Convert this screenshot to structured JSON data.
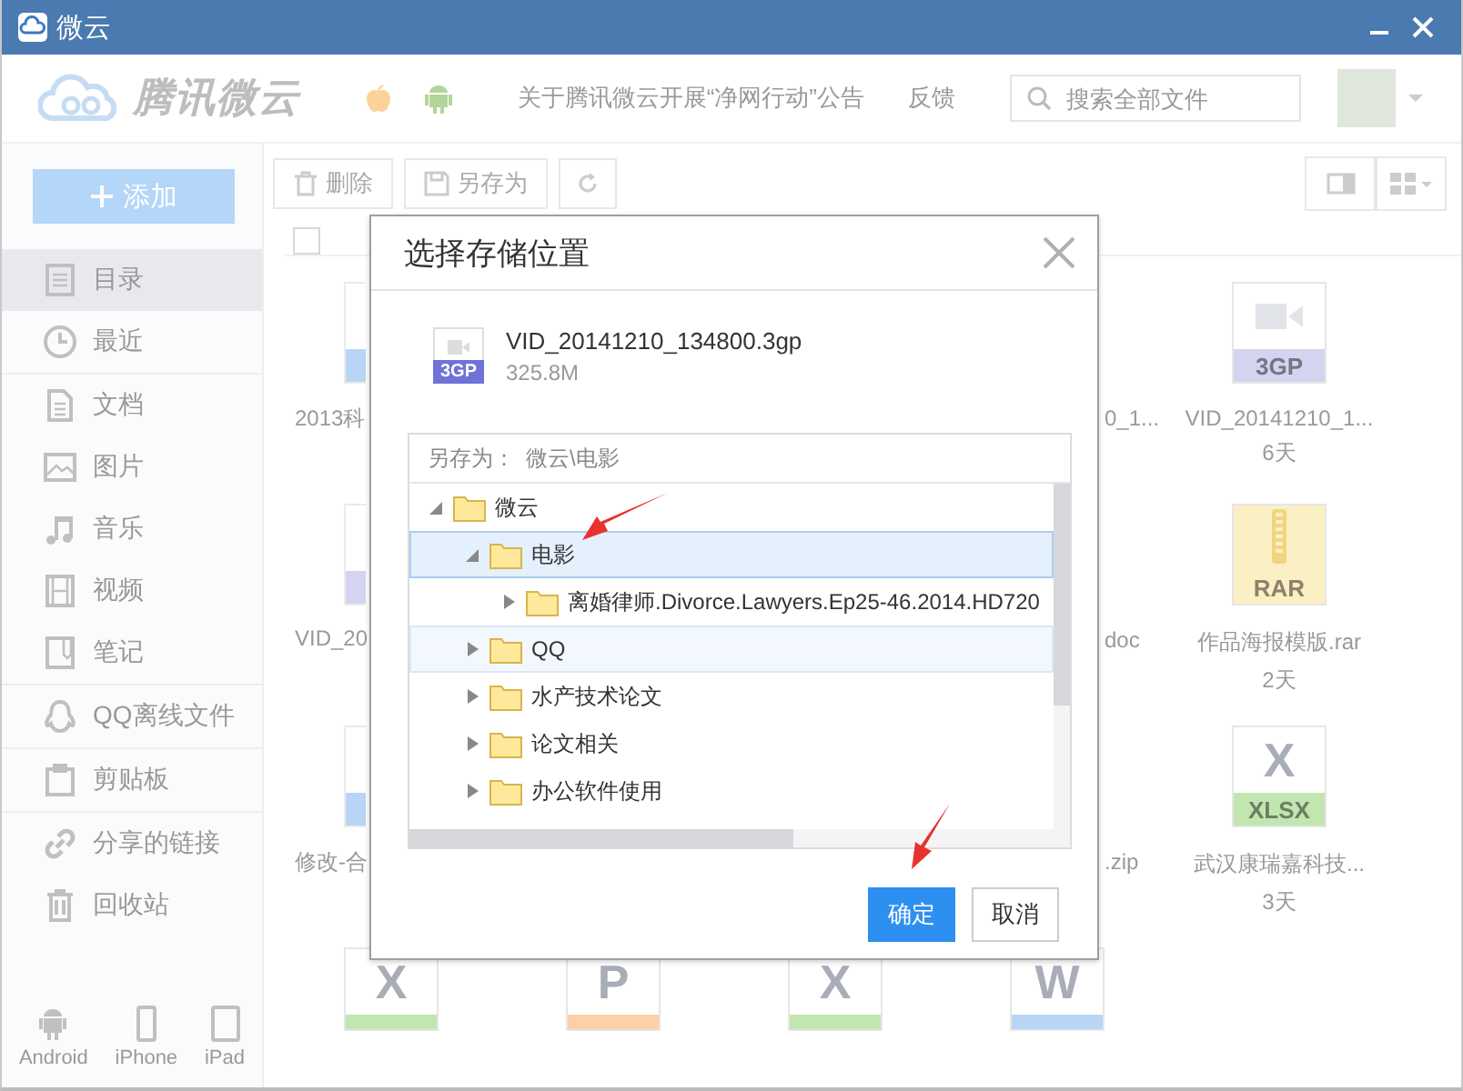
{
  "window": {
    "title": "微云"
  },
  "header": {
    "logo_text": "腾讯微云",
    "notice": "关于腾讯微云开展“净网行动”公告",
    "feedback": "反馈",
    "search": {
      "placeholder": "搜索全部文件"
    }
  },
  "sidebar": {
    "add_button": "添加",
    "items": [
      {
        "label": "目录",
        "selected": true
      },
      {
        "label": "最近",
        "selected": false
      },
      {
        "label": "文档",
        "selected": false
      },
      {
        "label": "图片",
        "selected": false
      },
      {
        "label": "音乐",
        "selected": false
      },
      {
        "label": "视频",
        "selected": false
      },
      {
        "label": "笔记",
        "selected": false
      },
      {
        "label": "QQ离线文件",
        "selected": false
      },
      {
        "label": "剪贴板",
        "selected": false
      },
      {
        "label": "分享的链接",
        "selected": false
      },
      {
        "label": "回收站",
        "selected": false
      }
    ],
    "devices": [
      {
        "label": "Android"
      },
      {
        "label": "iPhone"
      },
      {
        "label": "iPad"
      }
    ]
  },
  "toolbar": {
    "delete": "删除",
    "save_as": "另存为"
  },
  "select_all": {
    "checked": false
  },
  "file_rows": [
    {
      "left": {
        "name": "2013科",
        "color": "#b8d5f5"
      },
      "edge": {
        "name": "0_1..."
      },
      "right": {
        "name": "VID_20141210_1...",
        "date": "6天",
        "kind": "video",
        "type": "3GP",
        "color": "#d4d4f0"
      }
    },
    {
      "left": {
        "name": "VID_20",
        "color": "#d4d4f0"
      },
      "edge": {
        "name": "doc"
      },
      "right": {
        "name": "作品海报模版.rar",
        "date": "2天",
        "kind": "archive",
        "type": "RAR",
        "color": "#fbefc4"
      }
    },
    {
      "left": {
        "name": "修改-合",
        "color": "#b8d5f5"
      },
      "edge": {
        "name": ".zip"
      },
      "right": {
        "name": "武汉康瑞嘉科技...",
        "date": "3天",
        "kind": "letter",
        "letter": "X",
        "type": "XLSX",
        "color": "#c2e6b0"
      }
    }
  ],
  "bottom_row": [
    {
      "letter": "X",
      "color": "#c2e6b0"
    },
    {
      "letter": "P",
      "color": "#fdd0a8"
    },
    {
      "letter": "X",
      "color": "#c2e6b0"
    },
    {
      "letter": "W",
      "color": "#b8d5f5"
    }
  ],
  "dialog": {
    "title": "选择存储位置",
    "file": {
      "name": "VID_20141210_134800.3gp",
      "size": "325.8M",
      "type": "3GP"
    },
    "save_as_label": "另存为：",
    "save_as_path": "微云\\电影",
    "tree": [
      {
        "label": "微云",
        "expanded": true,
        "selected": false,
        "highlighted": false,
        "children": [
          {
            "label": "电影",
            "expanded": true,
            "selected": true,
            "highlighted": false,
            "children": [
              {
                "label": "离婚律师.Divorce.Lawyers.Ep25-46.2014.HD720",
                "expanded": false,
                "selected": false,
                "highlighted": false
              }
            ]
          },
          {
            "label": "QQ",
            "expanded": false,
            "selected": false,
            "highlighted": true
          },
          {
            "label": "水产技术论文",
            "expanded": false,
            "selected": false,
            "highlighted": false
          },
          {
            "label": "论文相关",
            "expanded": false,
            "selected": false,
            "highlighted": false
          },
          {
            "label": "办公软件使用",
            "expanded": false,
            "selected": false,
            "highlighted": false
          }
        ]
      }
    ],
    "ok": "确定",
    "cancel": "取消"
  }
}
